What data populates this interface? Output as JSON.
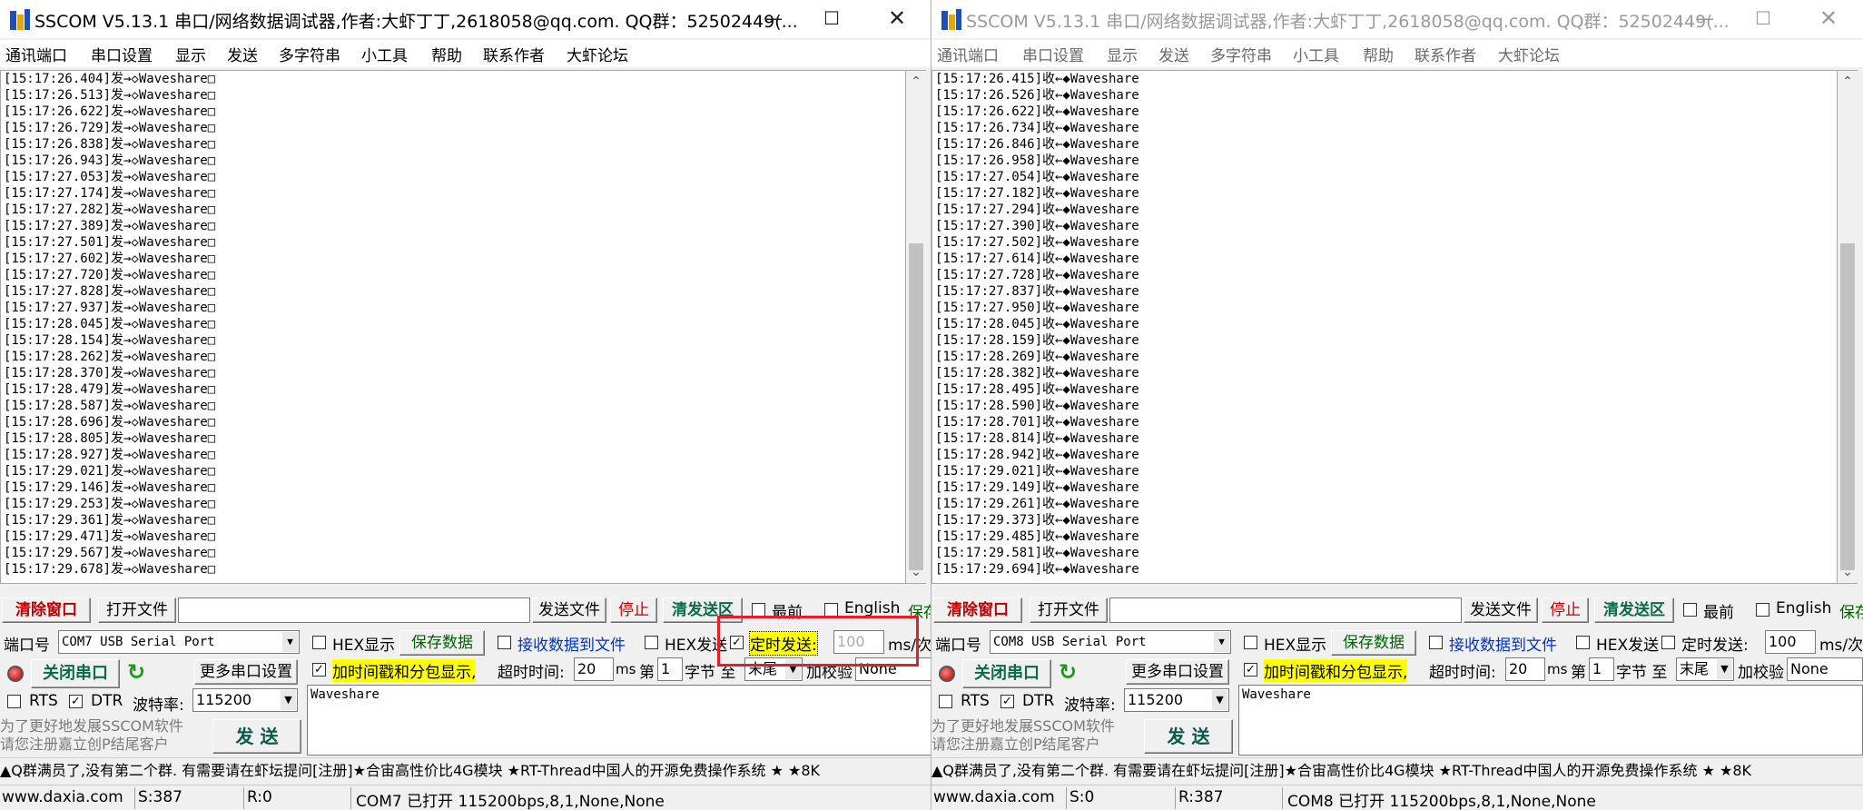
{
  "windows": [
    {
      "id": "left",
      "title": "SSCOM V5.13.1 串口/网络数据调试器,作者:大虾丁丁,2618058@qq.com. QQ群：52502449(...",
      "menu": [
        "通讯端口",
        "串口设置",
        "显示",
        "发送",
        "多字符串",
        "小工具",
        "帮助",
        "联系作者",
        "大虾论坛"
      ],
      "log_lines": [
        "[15:17:26.404]发→◇Waveshare□",
        "[15:17:26.513]发→◇Waveshare□",
        "[15:17:26.622]发→◇Waveshare□",
        "[15:17:26.729]发→◇Waveshare□",
        "[15:17:26.838]发→◇Waveshare□",
        "[15:17:26.943]发→◇Waveshare□",
        "[15:17:27.053]发→◇Waveshare□",
        "[15:17:27.174]发→◇Waveshare□",
        "[15:17:27.282]发→◇Waveshare□",
        "[15:17:27.389]发→◇Waveshare□",
        "[15:17:27.501]发→◇Waveshare□",
        "[15:17:27.602]发→◇Waveshare□",
        "[15:17:27.720]发→◇Waveshare□",
        "[15:17:27.828]发→◇Waveshare□",
        "[15:17:27.937]发→◇Waveshare□",
        "[15:17:28.045]发→◇Waveshare□",
        "[15:17:28.154]发→◇Waveshare□",
        "[15:17:28.262]发→◇Waveshare□",
        "[15:17:28.370]发→◇Waveshare□",
        "[15:17:28.479]发→◇Waveshare□",
        "[15:17:28.587]发→◇Waveshare□",
        "[15:17:28.696]发→◇Waveshare□",
        "[15:17:28.805]发→◇Waveshare□",
        "[15:17:28.927]发→◇Waveshare□",
        "[15:17:29.021]发→◇Waveshare□",
        "[15:17:29.146]发→◇Waveshare□",
        "[15:17:29.253]发→◇Waveshare□",
        "[15:17:29.361]发→◇Waveshare□",
        "[15:17:29.471]发→◇Waveshare□",
        "[15:17:29.567]发→◇Waveshare□",
        "[15:17:29.678]发→◇Waveshare□"
      ],
      "row1": {
        "clear": "清除窗口",
        "open_file": "打开文件",
        "send_file": "发送文件",
        "stop": "停止",
        "clear_send": "清发送区",
        "front": "最前",
        "english": "English",
        "save_param": "保存参数"
      },
      "row2": {
        "port_label": "端口号",
        "port_value": "COM7 USB Serial Port",
        "hex_display": "HEX显示",
        "save_data": "保存数据",
        "recv_to_file": "接收数据到文件",
        "hex_send": "HEX发送",
        "timed_send": "定时发送:",
        "interval": "100",
        "unit": "ms/次"
      },
      "row3": {
        "close_port": "关闭串口",
        "more_settings": "更多串口设置",
        "timestamp": "加时间戳和分包显示,",
        "timeout_label": "超时时间:",
        "timeout": "20",
        "ms": "ms",
        "di": "第",
        "byte_from": "1",
        "byte_label": "字节 至",
        "byte_to": "末尾",
        "checksum_label": "加校验",
        "checksum": "None"
      },
      "row4": {
        "rts": "RTS",
        "dtr": "DTR",
        "baud_label": "波特率:",
        "baud": "115200",
        "send_text": "Waveshare"
      },
      "promo_side": "为了更好地发展SSCOM软件\n请您注册嘉立创P结尾客户",
      "send_button": "发 送",
      "timed_checked": true,
      "promo": "▲Q群满员了,没有第二个群. 有需要请在虾坛提问[注册]★合宙高性价比4G模块 ★RT-Thread中国人的开源免费操作系统 ★ ★8K",
      "status": {
        "site": "www.daxia.com",
        "s": "S:387",
        "r": "R:0",
        "port_state": "COM7 已打开  115200bps,8,1,None,None"
      }
    },
    {
      "id": "right",
      "title": "SSCOM V5.13.1 串口/网络数据调试器,作者:大虾丁丁,2618058@qq.com. QQ群：52502449(...",
      "menu": [
        "通讯端口",
        "串口设置",
        "显示",
        "发送",
        "多字符串",
        "小工具",
        "帮助",
        "联系作者",
        "大虾论坛"
      ],
      "log_lines": [
        "[15:17:26.415]收←◆Waveshare",
        "[15:17:26.526]收←◆Waveshare",
        "[15:17:26.622]收←◆Waveshare",
        "[15:17:26.734]收←◆Waveshare",
        "[15:17:26.846]收←◆Waveshare",
        "[15:17:26.958]收←◆Waveshare",
        "[15:17:27.054]收←◆Waveshare",
        "[15:17:27.182]收←◆Waveshare",
        "[15:17:27.294]收←◆Waveshare",
        "[15:17:27.390]收←◆Waveshare",
        "[15:17:27.502]收←◆Waveshare",
        "[15:17:27.614]收←◆Waveshare",
        "[15:17:27.728]收←◆Waveshare",
        "[15:17:27.837]收←◆Waveshare",
        "[15:17:27.950]收←◆Waveshare",
        "[15:17:28.045]收←◆Waveshare",
        "[15:17:28.159]收←◆Waveshare",
        "[15:17:28.269]收←◆Waveshare",
        "[15:17:28.382]收←◆Waveshare",
        "[15:17:28.495]收←◆Waveshare",
        "[15:17:28.590]收←◆Waveshare",
        "[15:17:28.701]收←◆Waveshare",
        "[15:17:28.814]收←◆Waveshare",
        "[15:17:28.942]收←◆Waveshare",
        "[15:17:29.021]收←◆Waveshare",
        "[15:17:29.149]收←◆Waveshare",
        "[15:17:29.261]收←◆Waveshare",
        "[15:17:29.373]收←◆Waveshare",
        "[15:17:29.485]收←◆Waveshare",
        "[15:17:29.581]收←◆Waveshare",
        "[15:17:29.694]收←◆Waveshare"
      ],
      "row1": {
        "clear": "清除窗口",
        "open_file": "打开文件",
        "send_file": "发送文件",
        "stop": "停止",
        "clear_send": "清发送区",
        "front": "最前",
        "english": "English",
        "save_param": "保存参数"
      },
      "row2": {
        "port_label": "端口号",
        "port_value": "COM8 USB Serial Port",
        "hex_display": "HEX显示",
        "save_data": "保存数据",
        "recv_to_file": "接收数据到文件",
        "hex_send": "HEX发送",
        "timed_send": "定时发送:",
        "interval": "100",
        "unit": "ms/次"
      },
      "row3": {
        "close_port": "关闭串口",
        "more_settings": "更多串口设置",
        "timestamp": "加时间戳和分包显示,",
        "timeout_label": "超时时间:",
        "timeout": "20",
        "ms": "ms",
        "di": "第",
        "byte_from": "1",
        "byte_label": "字节 至",
        "byte_to": "末尾",
        "checksum_label": "加校验",
        "checksum": "None"
      },
      "row4": {
        "rts": "RTS",
        "dtr": "DTR",
        "baud_label": "波特率:",
        "baud": "115200",
        "send_text": "Waveshare"
      },
      "promo_side": "为了更好地发展SSCOM软件\n请您注册嘉立创P结尾客户",
      "send_button": "发 送",
      "timed_checked": false,
      "promo": "▲Q群满员了,没有第二个群. 有需要请在虾坛提问[注册]★合宙高性价比4G模块 ★RT-Thread中国人的开源免费操作系统 ★ ★8K",
      "status": {
        "site": "www.daxia.com",
        "s": "S:0",
        "r": "R:387",
        "port_state": "COM8 已打开  115200bps,8,1,None,None"
      }
    }
  ],
  "window_controls": {
    "minimize": "—",
    "maximize": "☐",
    "close": "✕"
  },
  "colors": {
    "highlight_box": "#e0202a",
    "yellow_highlight": "#ffff00",
    "inactive_title": "#9a9a9a"
  }
}
